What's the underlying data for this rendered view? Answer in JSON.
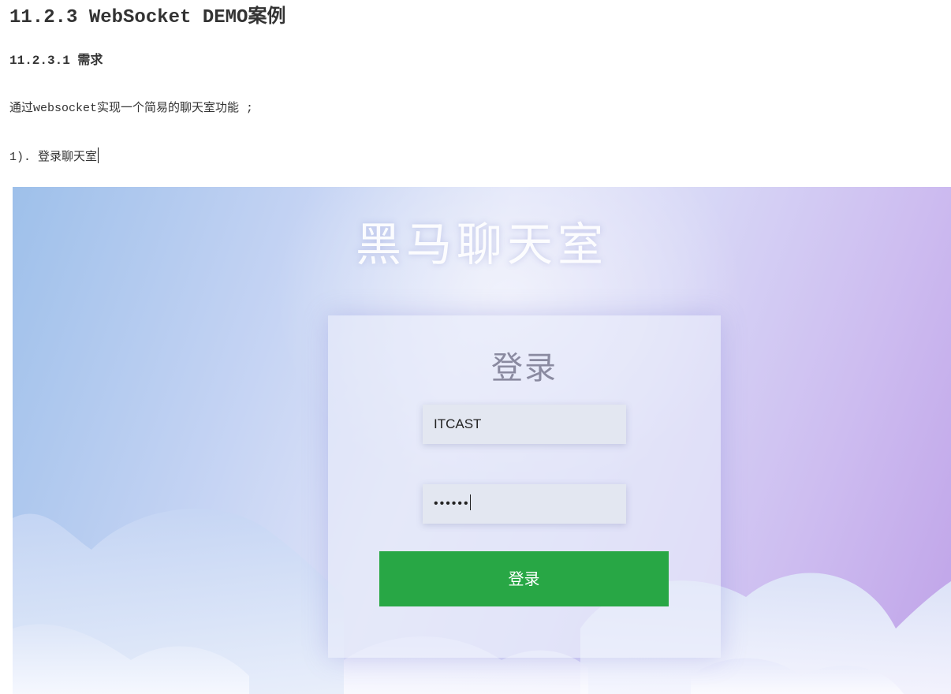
{
  "doc": {
    "heading": "11.2.3 WebSocket DEMO案例",
    "subheading": "11.2.3.1 需求",
    "paragraph": "通过websocket实现一个简易的聊天室功能 ;",
    "step": "1). 登录聊天室"
  },
  "login_page": {
    "site_title": "黑马聊天室",
    "form_title": "登录",
    "username_value": "ITCAST",
    "password_mask": "••••••",
    "submit_label": "登录",
    "button_color": "#28a745"
  }
}
